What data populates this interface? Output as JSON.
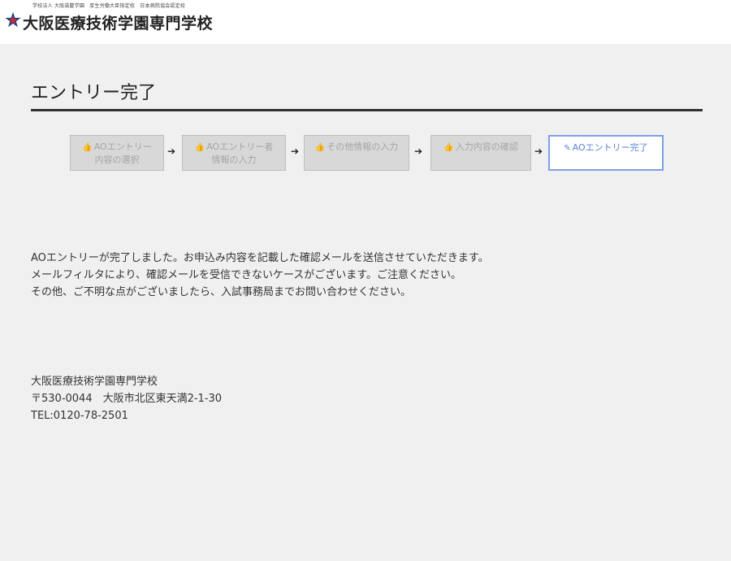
{
  "header": {
    "small_text": "学校法人 大阪滋慶学園　厚生労働大臣指定校　日本病院協会認定校",
    "school_name": "大阪医療技術学園専門学校",
    "logo_icon": "star-logo-icon"
  },
  "page": {
    "title": "エントリー完了"
  },
  "steps": [
    {
      "line1": "AOエントリー",
      "line2": "内容の選択",
      "icon": "thumbs-up-icon",
      "active": false
    },
    {
      "line1": "AOエントリー者",
      "line2": "情報の入力",
      "icon": "thumbs-up-icon",
      "active": false
    },
    {
      "line1": "その他情報の入力",
      "line2": "",
      "icon": "thumbs-up-icon",
      "active": false
    },
    {
      "line1": "入力内容の確認",
      "line2": "",
      "icon": "thumbs-up-icon",
      "active": false
    },
    {
      "line1": "AOエントリー完了",
      "line2": "",
      "icon": "edit-icon",
      "active": true
    }
  ],
  "step_arrow": "➔",
  "message": {
    "line1": "AOエントリーが完了しました。お申込み内容を記載した確認メールを送信させていただきます。",
    "line2": "メールフィルタにより、確認メールを受信できないケースがございます。ご注意ください。",
    "line3": "その他、ご不明な点がございましたら、入試事務局までお問い合わせください。"
  },
  "address": {
    "name": "大阪医療技術学園専門学校",
    "postal": "〒530-0044　大阪市北区東天満2-1-30",
    "tel": "TEL:0120-78-2501"
  },
  "colors": {
    "background": "#f0f0f0",
    "header_bg": "#ffffff",
    "step_inactive_bg": "#d8d8d8",
    "step_inactive_text": "#a5a5a5",
    "step_active_border": "#7ea0e6",
    "step_active_text": "#5a82d6",
    "logo_red": "#d42b2b",
    "logo_blue": "#1d3f8a"
  }
}
